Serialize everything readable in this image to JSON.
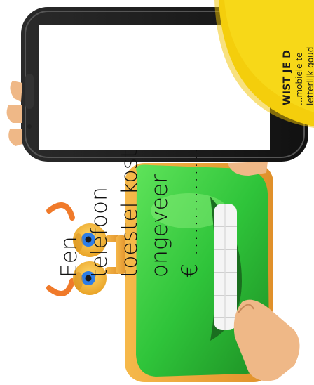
{
  "phone_screen": {
    "lines": [
      "Een",
      "telefoon",
      "toestel kost",
      "ongeveer",
      "€ ……………"
    ]
  },
  "badge": {
    "title": "WIST JE D",
    "line1": "...mobiele te",
    "line2": "letterlijk goud"
  },
  "colors": {
    "mascot_green": "#2fc43a",
    "mascot_orange": "#f2a531",
    "badge_yellow": "#f7d818",
    "phone_black": "#1b1b1b",
    "skin": "#e9b07f"
  }
}
